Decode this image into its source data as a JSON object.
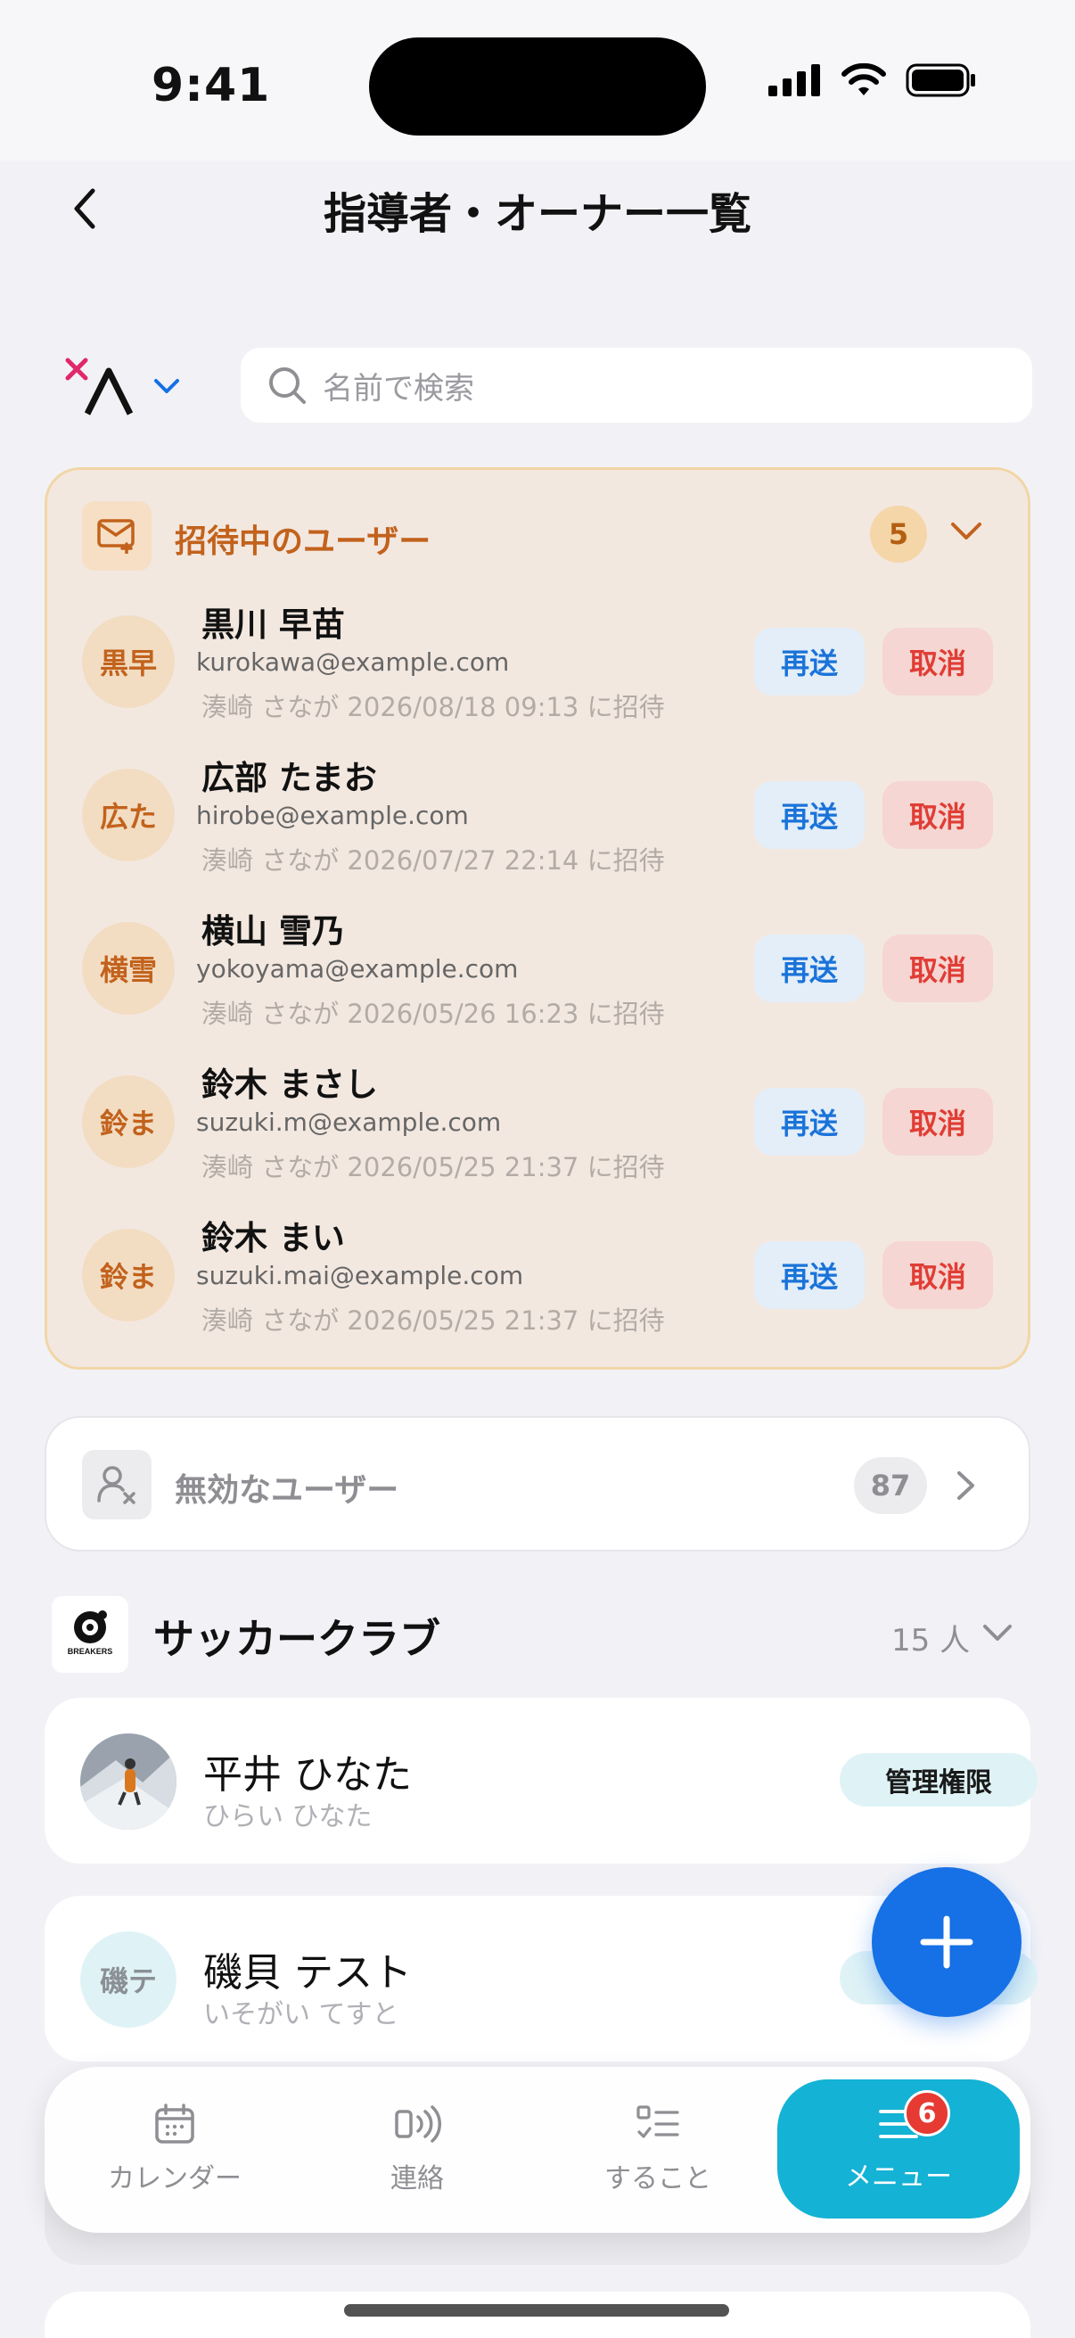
{
  "status_bar": {
    "time": "9:41"
  },
  "header": {
    "title": "指導者・オーナー一覧"
  },
  "filter": {
    "search_placeholder": "名前で検索"
  },
  "invited": {
    "title": "招待中のユーザー",
    "count": "5",
    "resend_label": "再送",
    "cancel_label": "取消",
    "users": [
      {
        "initials": "黒早",
        "name": "黒川 早苗",
        "email": "kurokawa@example.com",
        "meta": "湊崎 さなが 2026/08/18 09:13 に招待"
      },
      {
        "initials": "広た",
        "name": "広部 たまお",
        "email": "hirobe@example.com",
        "meta": "湊崎 さなが 2026/07/27 22:14 に招待"
      },
      {
        "initials": "横雪",
        "name": "横山 雪乃",
        "email": "yokoyama@example.com",
        "meta": "湊崎 さなが 2026/05/26 16:23 に招待"
      },
      {
        "initials": "鈴ま",
        "name": "鈴木 まさし",
        "email": "suzuki.m@example.com",
        "meta": "湊崎 さなが 2026/05/25 21:37 に招待"
      },
      {
        "initials": "鈴ま",
        "name": "鈴木 まい",
        "email": "suzuki.mai@example.com",
        "meta": "湊崎 さなが 2026/05/25 21:37 に招待"
      }
    ]
  },
  "inactive": {
    "label": "無効なユーザー",
    "count": "87"
  },
  "club": {
    "logo_text": "BREAKERS",
    "name": "サッカークラブ",
    "count": "15 人"
  },
  "members": [
    {
      "name": "平井 ひなた",
      "kana": "ひらい ひなた",
      "role": "管理権限"
    },
    {
      "initials": "磯テ",
      "name": "磯貝 テスト",
      "kana": "いそがい てすと",
      "role": "管理権限"
    }
  ],
  "tabbar": {
    "tabs": [
      {
        "label": "カレンダー",
        "icon": "calendar-icon"
      },
      {
        "label": "連絡",
        "icon": "broadcast-icon"
      },
      {
        "label": "すること",
        "icon": "checklist-icon"
      },
      {
        "label": "メニュー",
        "icon": "menu-icon"
      }
    ],
    "menu_badge": "6"
  },
  "colors": {
    "accent_blue": "#1670e6",
    "active_tab": "#14b2d4",
    "invited_orange": "#c2621c",
    "cancel_red": "#e03d35"
  }
}
